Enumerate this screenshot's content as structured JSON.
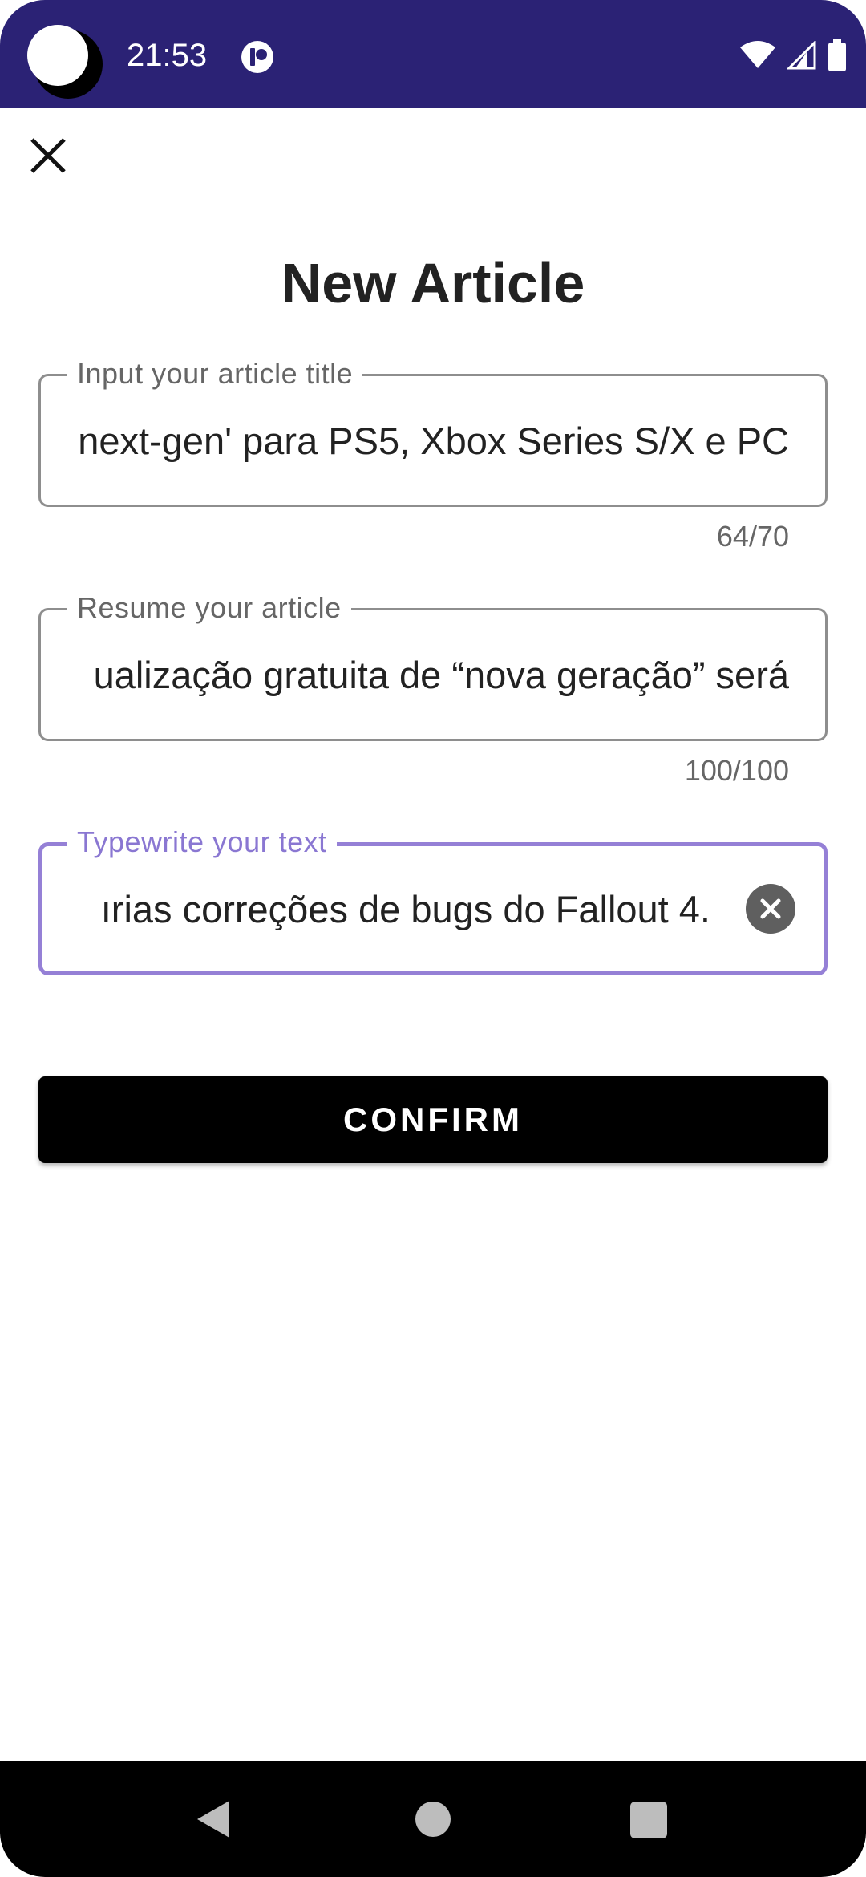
{
  "status_bar": {
    "time": "21:53",
    "background_color": "#2b2275",
    "icons": [
      "app-notification-icon",
      "wifi-icon",
      "cellular-signal-icon",
      "battery-icon"
    ]
  },
  "header": {
    "close_icon": "close-icon"
  },
  "page": {
    "title": "New Article"
  },
  "form": {
    "title_field": {
      "label": "Input your article title",
      "value": "'next-gen' para PS5, Xbox Series S/X e PC",
      "counter": "64/70"
    },
    "summary_field": {
      "label": "Resume your article",
      "value": "ualização gratuita de “nova geração” será",
      "counter": "100/100"
    },
    "text_field": {
      "label": "Typewrite your text",
      "value": "ırias correções de bugs do Fallout 4.",
      "focused": true,
      "focus_color": "#9580d6",
      "trailing_icon": "clear-circle-icon"
    },
    "confirm_label": "CONFIRM"
  },
  "nav_bar": {
    "icons": [
      "back-icon",
      "home-icon",
      "recents-icon"
    ]
  }
}
